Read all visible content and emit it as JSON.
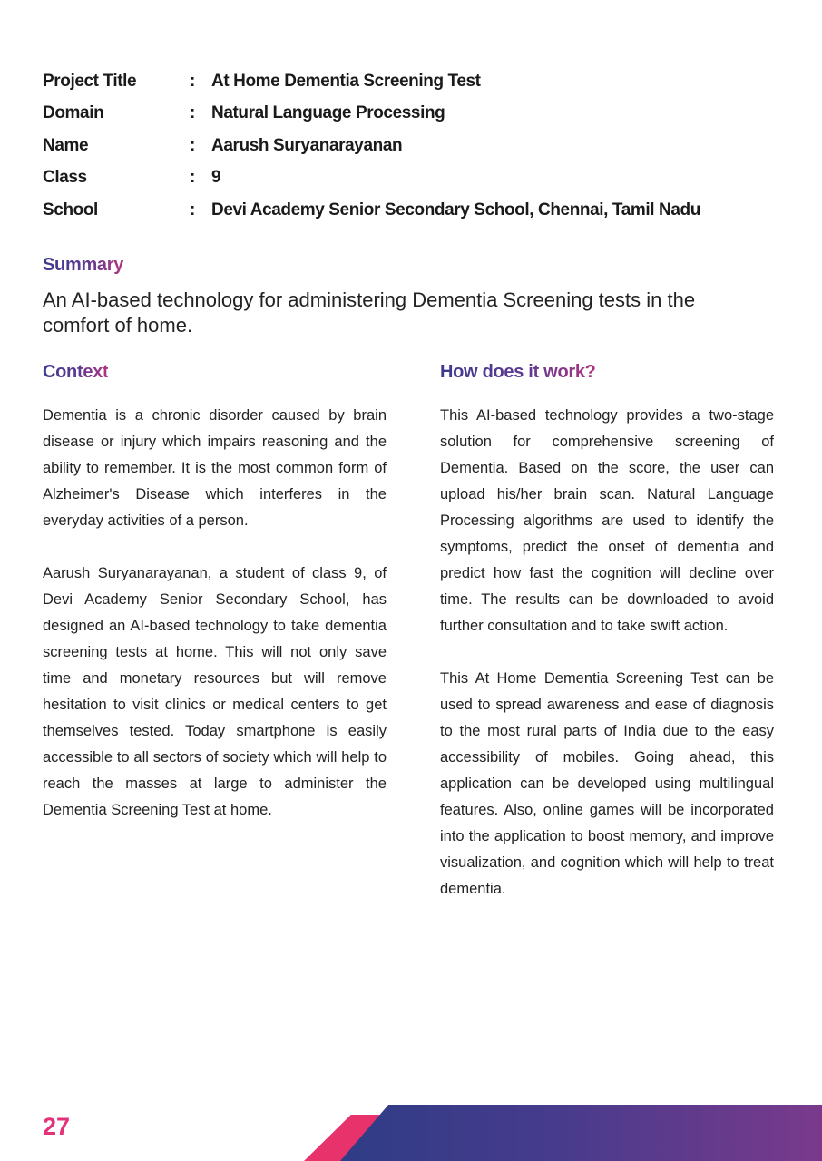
{
  "info": [
    {
      "label": "Project Title",
      "colon": ":",
      "value": "At Home Dementia Screening Test"
    },
    {
      "label": "Domain",
      "colon": ":",
      "value": "Natural Language Processing"
    },
    {
      "label": "Name",
      "colon": ":",
      "value": "Aarush Suryanarayanan"
    },
    {
      "label": "Class",
      "colon": ":",
      "value": "9"
    },
    {
      "label": "School",
      "colon": ":",
      "value": "Devi Academy Senior Secondary School, Chennai, Tamil Nadu"
    }
  ],
  "summary": {
    "heading": "Summary",
    "text": "An AI-based technology for administering Dementia Screening tests in the comfort of home."
  },
  "context": {
    "heading": "Context",
    "paragraphs": [
      "Dementia is a chronic disorder caused by brain disease or injury which impairs reasoning and the ability to remember. It is the most common form of Alzheimer's Disease which interferes in the everyday activities of a person.",
      "Aarush Suryanarayanan, a student of class 9, of Devi Academy Senior Secondary School, has designed an AI-based technology to take dementia screening tests at home. This will not only save time and monetary resources but will remove hesitation to visit clinics or medical centers to get themselves tested. Today smartphone is easily accessible to all sectors of society which will help to reach the masses at large to administer the Dementia Screening Test at home."
    ]
  },
  "how": {
    "heading": "How does it work?",
    "paragraphs": [
      "This AI-based technology provides a two-stage solution for comprehensive screening of Dementia. Based on the score, the user can upload his/her brain scan. Natural Language Processing algorithms are used to identify the symptoms, predict the onset of dementia and predict how fast the cognition will decline over time. The results can be downloaded to avoid further consultation and to take swift action.",
      "This At Home Dementia Screening Test can be used to spread awareness and ease of diagnosis to the most rural parts of India due to the easy accessibility of mobiles. Going ahead, this application can be developed using multilingual features. Also, online games will be incorporated into the application to boost memory, and improve visualization, and cognition which will help to treat dementia."
    ]
  },
  "page_number": "27",
  "colors": {
    "heading_start": "#3d3a8e",
    "heading_end": "#b0357f",
    "page_number": "#e5317a",
    "band_pink": "#e8326b",
    "band_blue": "#2f3c86",
    "band_purple": "#7a3a8c"
  }
}
